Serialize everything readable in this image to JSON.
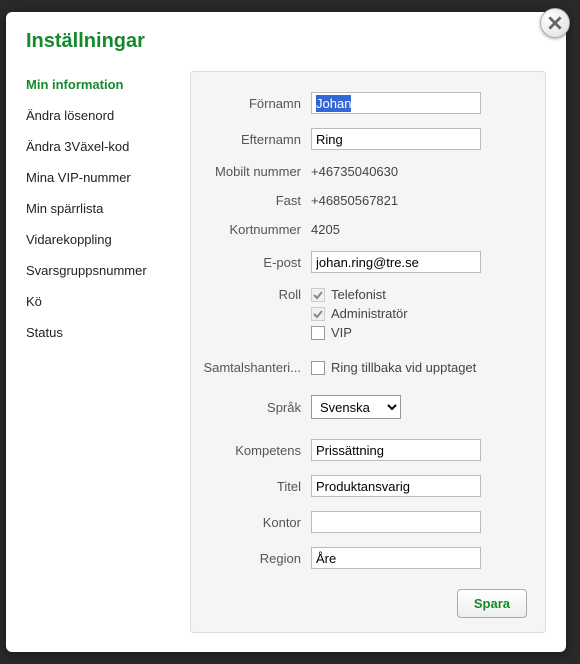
{
  "title": "Inställningar",
  "sidebar": {
    "items": [
      {
        "label": "Min information",
        "active": true
      },
      {
        "label": "Ändra lösenord"
      },
      {
        "label": "Ändra 3Växel-kod"
      },
      {
        "label": "Mina VIP-nummer"
      },
      {
        "label": "Min spärrlista"
      },
      {
        "label": "Vidarekoppling"
      },
      {
        "label": "Svarsgruppsnummer"
      },
      {
        "label": "Kö"
      },
      {
        "label": "Status"
      }
    ]
  },
  "form": {
    "fornamn": {
      "label": "Förnamn",
      "value": "Johan"
    },
    "efternamn": {
      "label": "Efternamn",
      "value": "Ring"
    },
    "mobil": {
      "label": "Mobilt nummer",
      "value": "+46735040630"
    },
    "fast": {
      "label": "Fast",
      "value": "+46850567821"
    },
    "kortnummer": {
      "label": "Kortnummer",
      "value": "4205"
    },
    "epost": {
      "label": "E-post",
      "value": "johan.ring@tre.se"
    },
    "roll": {
      "label": "Roll",
      "options": [
        {
          "label": "Telefonist",
          "checked": true,
          "disabled": true
        },
        {
          "label": "Administratör",
          "checked": true,
          "disabled": true
        },
        {
          "label": "VIP",
          "checked": false,
          "disabled": false
        }
      ]
    },
    "samtal": {
      "label": "Samtalshanteri...",
      "option": {
        "label": "Ring tillbaka vid upptaget",
        "checked": false
      }
    },
    "sprak": {
      "label": "Språk",
      "selected": "Svenska"
    },
    "kompetens": {
      "label": "Kompetens",
      "value": "Prissättning"
    },
    "titel": {
      "label": "Titel",
      "value": "Produktansvarig"
    },
    "kontor": {
      "label": "Kontor",
      "value": ""
    },
    "region": {
      "label": "Region",
      "value": "Åre"
    }
  },
  "buttons": {
    "save": "Spara"
  }
}
